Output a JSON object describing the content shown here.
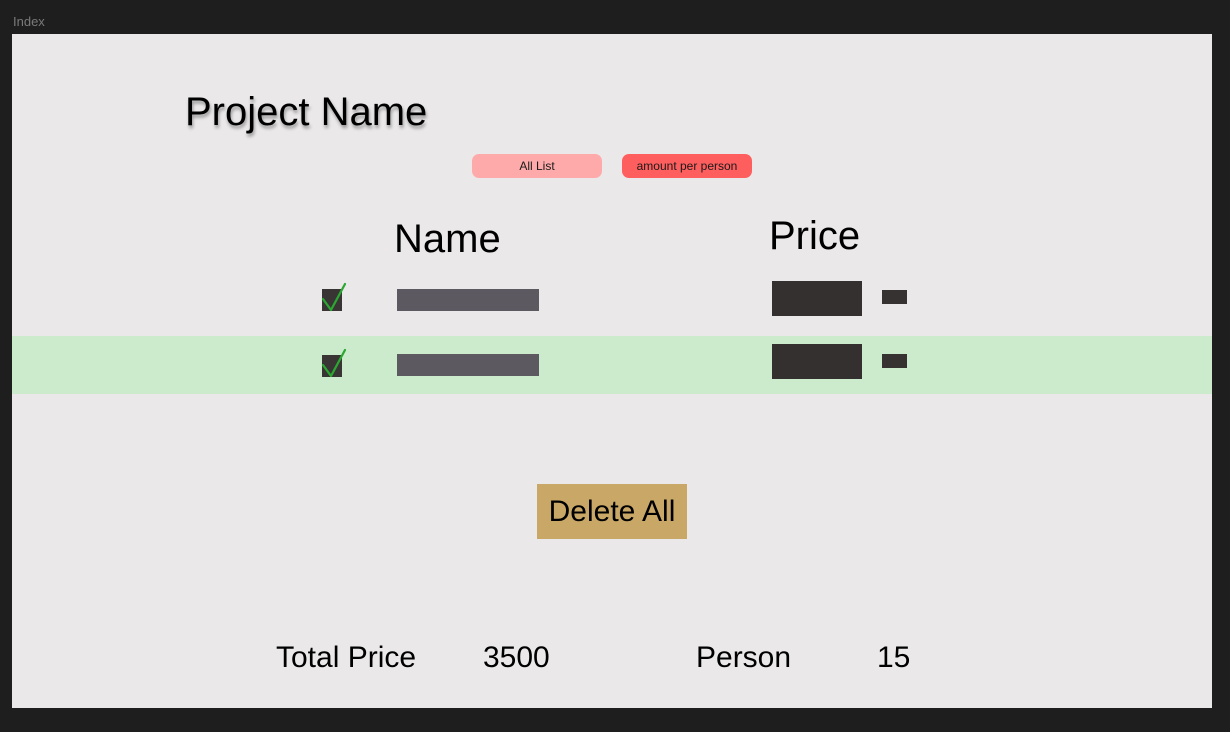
{
  "canvas": {
    "frame_label": "Index"
  },
  "header": {
    "title": "Project Name"
  },
  "filters": {
    "all_list_label": "All List",
    "amount_per_person_label": "amount per person"
  },
  "table": {
    "columns": {
      "name": "Name",
      "price": "Price"
    },
    "rows": [
      {
        "checked": true,
        "highlighted": false
      },
      {
        "checked": true,
        "highlighted": true
      }
    ]
  },
  "actions": {
    "delete_all_label": "Delete All"
  },
  "summary": {
    "total_price_label": "Total Price",
    "total_price_value": "3500",
    "person_label": "Person",
    "person_value": "15"
  },
  "colors": {
    "frame_background": "#eae8e8",
    "all_list_pill": "#ffaaaa",
    "amount_pill": "#ff5e5e",
    "row_highlight": "#ccebcd",
    "delete_button": "#c9a867",
    "checkmark": "#2aa830"
  }
}
